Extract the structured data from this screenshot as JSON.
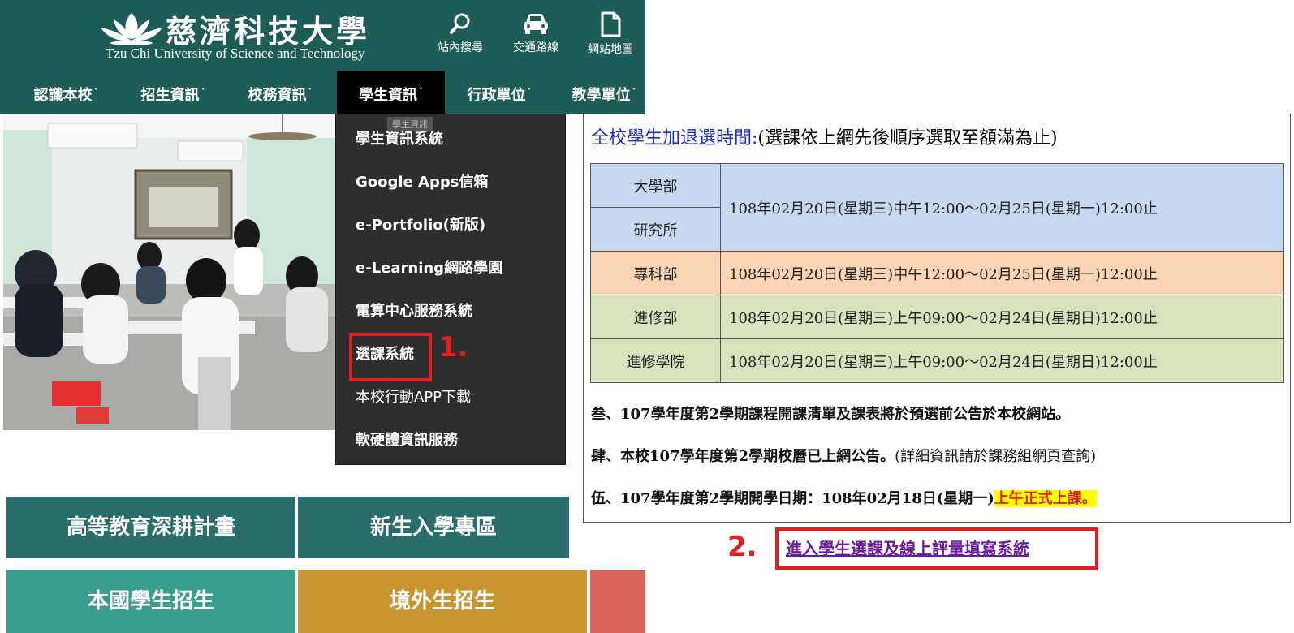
{
  "header": {
    "logo_cn": "慈濟科技大學",
    "logo_en": "Tzu Chi University of Science and Technology",
    "tools": [
      {
        "label": "站內搜尋",
        "icon": "search-icon"
      },
      {
        "label": "交通路線",
        "icon": "car-icon"
      },
      {
        "label": "網站地圖",
        "icon": "document-icon"
      }
    ]
  },
  "nav": {
    "items": [
      {
        "label": "認識本校"
      },
      {
        "label": "招生資訊"
      },
      {
        "label": "校務資訊"
      },
      {
        "label": "學生資訊",
        "active": true
      },
      {
        "label": "行政單位"
      },
      {
        "label": "教學單位"
      }
    ],
    "caret": "˅"
  },
  "dropdown": {
    "tooltip": "學生資訊",
    "items": [
      "學生資訊系統",
      "Google Apps信箱",
      "e-Portfolio(新版)",
      "e-Learning網路學園",
      "電算中心服務系統",
      "選課系統",
      "本校行動APP下載",
      "軟硬體資訊服務"
    ],
    "callout": "1."
  },
  "tiles": [
    {
      "label": "高等教育深耕計畫",
      "color": "#2a6d6a"
    },
    {
      "label": "新生入學專區",
      "color": "#2a6d6a"
    },
    {
      "label": "本國學生招生",
      "color": "#3a9e8e"
    },
    {
      "label": "境外生招生",
      "color": "#c8962e"
    },
    {
      "label": "",
      "color": "#d9655a"
    }
  ],
  "schedule": {
    "title_blue": "全校學生加退選時間:",
    "title_black": "(選課依上網先後順序選取至額滿為止)",
    "rows": [
      {
        "label": "大學部",
        "time": "108年02月20日(星期三)中午12:00～02月25日(星期一)12:00止",
        "color": "#c6d9f0"
      },
      {
        "label": "研究所",
        "time": "",
        "color": "#c6d9f0"
      },
      {
        "label": "專科部",
        "time": "108年02月20日(星期三)中午12:00～02月25日(星期一)12:00止",
        "color": "#fbd4b4"
      },
      {
        "label": "進修部",
        "time": "108年02月20日(星期三)上午09:00～02月24日(星期日)12:00止",
        "color": "#d6e3bc"
      },
      {
        "label": "進修學院",
        "time": "108年02月20日(星期三)上午09:00～02月24日(星期日)12:00止",
        "color": "#d6e3bc"
      }
    ]
  },
  "notices": {
    "n3": "叁、107學年度第2學期課程開課清單及課表將於預選前公告於本校網站。",
    "n4_bold": "肆、本校107學年度第2學期校曆已上網公告。",
    "n4_rest": "(詳細資訊請於課務組網頁查詢)",
    "n5_bold": "伍、107學年度第2學期開學日期：108年02月18日(星期一)",
    "n5_highlight": "上午正式上課。"
  },
  "link": {
    "label": "進入學生選課及線上評量填寫系統",
    "callout": "2."
  }
}
